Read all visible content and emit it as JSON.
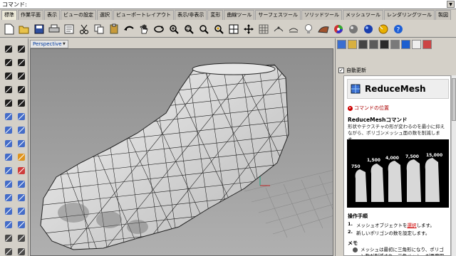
{
  "command_line": {
    "text": "コマンド:"
  },
  "tabs": [
    "標準",
    "作業平面",
    "表示",
    "ビューの設定",
    "選択",
    "ビューポートレイアウト",
    "表示/非表示",
    "変形",
    "曲線ツール",
    "サーフェスツール",
    "ソリッドツール",
    "メッシュツール",
    "レンダリングツール",
    "製図"
  ],
  "toolbar_icons": [
    "new-icon",
    "open-icon",
    "save-icon",
    "print-icon",
    "properties-icon",
    "cut-icon",
    "copy-icon",
    "paste-icon",
    "undo-icon",
    "pan-icon",
    "rotate-icon",
    "zoom-icon",
    "zoom-window-icon",
    "zoom-extents-icon",
    "zoom-selected-icon",
    "viewport-layout-icon",
    "move-icon",
    "grid-icon",
    "osnap-icon",
    "layer-icon",
    "light-icon",
    "material-icon",
    "color-wheel-icon",
    "render-icon",
    "sphere-icon",
    "shaded-icon",
    "help-icon"
  ],
  "viewport": {
    "label": "Perspective"
  },
  "right_panel": {
    "auto_update_label": "自動更新",
    "command_title": "ReduceMesh",
    "command_location_link": "コマンドの位置",
    "section_heading": "ReduceMeshコマンド",
    "description": "形状やテクスチャの形が変わるのを最小に抑えながら、ポリゴンメッシュ面の数を削減します。",
    "image_labels": [
      "750",
      "1,500",
      "4,000",
      "7,500",
      "15,000"
    ],
    "steps_title": "操作手順",
    "steps": [
      {
        "num": "1.",
        "pre": "メッシュオブジェクトを",
        "link": "選択",
        "post": "します。"
      },
      {
        "num": "2.",
        "pre": "新しいポリゴンの数を設定します。",
        "link": "",
        "post": ""
      }
    ],
    "memo_title": "メモ",
    "memo_text": "メッシュは最初に三角形になり、ポリゴン数が削減され、三角メッシュが再度四角メッシュに"
  },
  "colors": {
    "viewport_bg": "#a0a0a0",
    "panel_bg": "#d4d0c8",
    "link_red": "#cc0000"
  }
}
